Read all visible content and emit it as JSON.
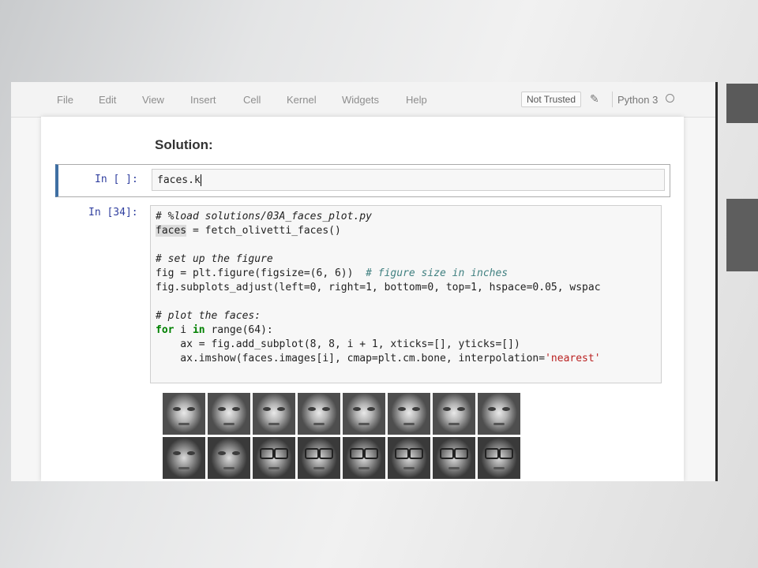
{
  "menu": {
    "items": [
      "File",
      "Edit",
      "View",
      "Insert",
      "Cell",
      "Kernel",
      "Widgets",
      "Help"
    ],
    "trust_badge": "Not Trusted",
    "kernel_name": "Python 3"
  },
  "notebook": {
    "heading": "Solution:",
    "cell_1": {
      "prompt": "In [ ]:",
      "source": "faces.k"
    },
    "cell_2": {
      "prompt": "In [34]:",
      "lines": {
        "l1": "# %load solutions/03A_faces_plot.py",
        "l2a": "faces",
        "l2b": " = fetch_olivetti_faces()",
        "l4": "# set up the figure",
        "l5a": "fig = plt.figure(figsize=(6, 6))  ",
        "l5b": "# figure size in inches",
        "l6": "fig.subplots_adjust(left=0, right=1, bottom=0, top=1, hspace=0.05, wspac",
        "l8": "# plot the faces:",
        "l9a": "for",
        "l9b": " i ",
        "l9c": "in",
        "l9d": " range(64):",
        "l10": "    ax = fig.add_subplot(8, 8, i + 1, xticks=[], yticks=[])",
        "l11a": "    ax.imshow(faces.images[i], cmap=plt.cm.bone, interpolation=",
        "l11b": "'nearest'"
      }
    },
    "output": {
      "faces_grid": {
        "rows_visible": 2,
        "columns": 8,
        "row_1_glasses": [
          false,
          false,
          false,
          false,
          false,
          false,
          false,
          false
        ],
        "row_2_glasses": [
          false,
          false,
          true,
          true,
          true,
          true,
          true,
          true
        ]
      }
    }
  }
}
